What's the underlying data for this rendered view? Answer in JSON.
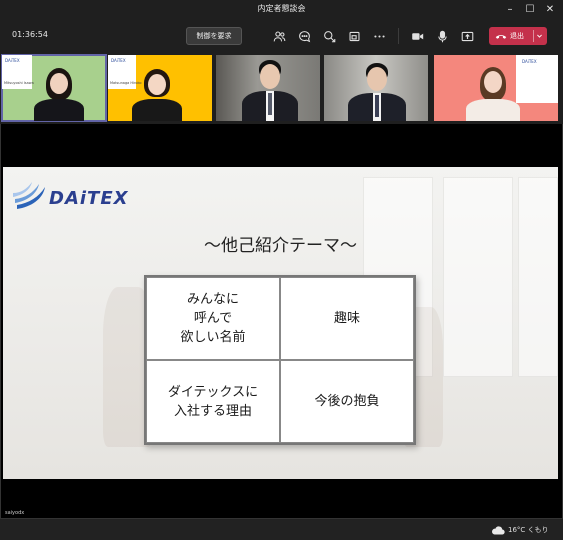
{
  "window": {
    "title": "内定者懇談会",
    "minimize": "–",
    "maximize": "☐",
    "close": "✕"
  },
  "toolbar": {
    "timer": "01:36:54",
    "control_request_label": "制御を要求",
    "leave_label": "退出",
    "leave_color": "#c4314b",
    "icons": [
      "people-icon",
      "chat-icon",
      "reactions-icon",
      "share-tray-icon",
      "more-icon",
      "camera-icon",
      "microphone-icon",
      "share-icon"
    ]
  },
  "participants": [
    {
      "id": "p1",
      "bg": "#a8d08d",
      "active": true,
      "card_text": "DAiTEX",
      "card_sub": "Mitsuyoshi Isawa",
      "card_color": "#ffffff"
    },
    {
      "id": "p2",
      "bg": "#ffc000",
      "active": false,
      "card_text": "DAiTEX",
      "card_sub": "Matsunaga Hiroko",
      "card_color": "#ffffff"
    },
    {
      "id": "p3",
      "bg": "#8a8a86",
      "active": false
    },
    {
      "id": "p4",
      "bg": "#9a9a96",
      "active": false
    },
    {
      "id": "p5",
      "bg": "#f4877d",
      "active": false,
      "card_text": "DAiTEX",
      "card_sub": "",
      "card_color": "#ffffff"
    }
  ],
  "slide": {
    "logo_text": "DAiTEX",
    "logo_color": "#2b3f8f",
    "title": "〜他己紹介テーマ〜",
    "cells": [
      "みんなに\n呼んで\n欲しい名前",
      "趣味",
      "ダイテックスに\n入社する理由",
      "今後の抱負"
    ]
  },
  "presenter": "saiyodx",
  "taskbar": {
    "weather": "16°C くもり"
  }
}
